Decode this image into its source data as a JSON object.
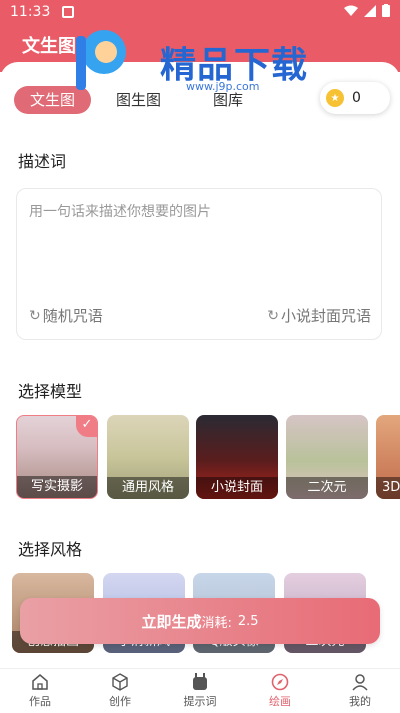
{
  "status": {
    "time": "11:33"
  },
  "header": {
    "title": "文生图"
  },
  "watermark": {
    "title": "精品下载",
    "url": "www.j9p.com"
  },
  "tabs": [
    {
      "label": "文生图",
      "active": true
    },
    {
      "label": "图生图",
      "active": false
    },
    {
      "label": "图库",
      "active": false
    }
  ],
  "coins": {
    "count": "0"
  },
  "prompt": {
    "section_title": "描述词",
    "placeholder": "用一句话来描述你想要的图片",
    "random_label": "随机咒语",
    "cover_label": "小说封面咒语"
  },
  "models": {
    "section_title": "选择模型",
    "items": [
      {
        "label": "写实摄影",
        "selected": true
      },
      {
        "label": "通用风格",
        "selected": false
      },
      {
        "label": "小说封面",
        "selected": false
      },
      {
        "label": "二次元",
        "selected": false
      },
      {
        "label": "3D",
        "selected": false
      }
    ]
  },
  "styles": {
    "section_title": "选择风格",
    "items": [
      {
        "label": "创意插画"
      },
      {
        "label": "小清新风"
      },
      {
        "label": "Q版头像"
      },
      {
        "label": "二次元"
      }
    ]
  },
  "generate": {
    "label": "立即生成",
    "cost_label": "消耗:",
    "cost_value": "2.5"
  },
  "nav": [
    {
      "label": "作品",
      "icon": "home-icon",
      "active": false
    },
    {
      "label": "创作",
      "icon": "cube-icon",
      "active": false
    },
    {
      "label": "提示词",
      "icon": "robot-icon",
      "active": false
    },
    {
      "label": "绘画",
      "icon": "compass-icon",
      "active": true
    },
    {
      "label": "我的",
      "icon": "user-icon",
      "active": false
    }
  ],
  "colors": {
    "accent": "#e95c67",
    "tab_active": "#e06a75",
    "coin": "#f6c233",
    "watermark": "#2466d2"
  }
}
